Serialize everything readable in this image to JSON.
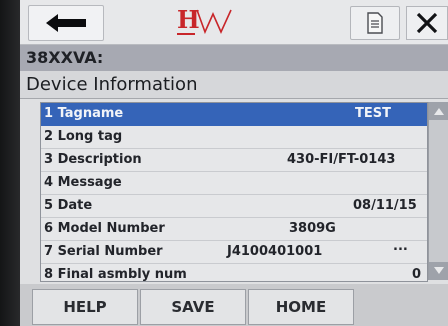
{
  "header": {
    "back_icon": "arrow-left-icon",
    "logo_text": "HW",
    "doc_icon": "document-icon",
    "close_icon": "close-icon"
  },
  "device": {
    "name": "38XXVA:"
  },
  "page": {
    "title": "Device Information"
  },
  "items": [
    {
      "label": "1 Tagname",
      "value": "TEST"
    },
    {
      "label": "2 Long tag",
      "value": ""
    },
    {
      "label": "3 Description",
      "value": "430-FI/FT-0143"
    },
    {
      "label": "4 Message",
      "value": ""
    },
    {
      "label": "5 Date",
      "value": "08/11/15"
    },
    {
      "label": "6 Model Number",
      "value": "3809G"
    },
    {
      "label": "7 Serial Number",
      "value": "J4100401001",
      "extra": "..."
    },
    {
      "label": "8 Final asmbly num",
      "value": "0"
    }
  ],
  "footer": {
    "help_label": "HELP",
    "save_label": "SAVE",
    "home_label": "HOME"
  },
  "colors": {
    "selection": "#3564b8",
    "logo_red": "#c8262a"
  }
}
